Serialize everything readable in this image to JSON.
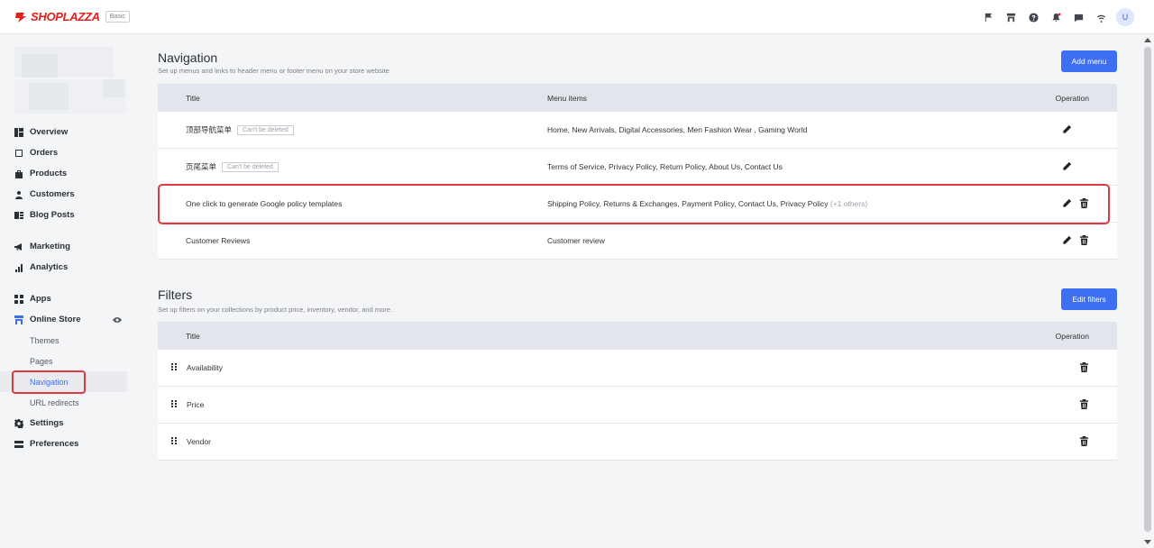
{
  "brand": {
    "name": "SHOPLAZZA",
    "plan": "Basic",
    "accent": "#e3201b"
  },
  "topbar": {
    "avatar_letter": "U",
    "icons": [
      "flag-icon",
      "store-icon",
      "help-icon",
      "bell-icon",
      "message-icon",
      "wifi-icon"
    ]
  },
  "sidebar": {
    "items": [
      {
        "label": "Overview",
        "icon": "overview-icon"
      },
      {
        "label": "Orders",
        "icon": "orders-icon"
      },
      {
        "label": "Products",
        "icon": "products-icon"
      },
      {
        "label": "Customers",
        "icon": "customers-icon"
      },
      {
        "label": "Blog Posts",
        "icon": "blog-icon"
      },
      {
        "label": "Marketing",
        "icon": "megaphone-icon"
      },
      {
        "label": "Analytics",
        "icon": "analytics-icon"
      },
      {
        "label": "Apps",
        "icon": "apps-icon"
      },
      {
        "label": "Online Store",
        "icon": "store-icon"
      },
      {
        "label": "Settings",
        "icon": "gear-icon"
      },
      {
        "label": "Preferences",
        "icon": "preferences-icon"
      }
    ],
    "sub_items": [
      "Themes",
      "Pages",
      "Navigation",
      "URL redirects"
    ],
    "active_sub": "Navigation"
  },
  "navigation": {
    "title": "Navigation",
    "description": "Set up menus and links to header menu or footer menu on your store website",
    "add_button": "Add menu",
    "columns": {
      "title": "Title",
      "items": "Menu items",
      "operation": "Operation"
    },
    "rows": [
      {
        "title": "顶部导航菜单",
        "tag": "Can't be deleted",
        "items": "Home, New Arrivals, Digital Accessories, Men Fashion Wear , Gaming World",
        "extra": ""
      },
      {
        "title": "页尾菜单",
        "tag": "Can't be deleted",
        "items": "Terms of Service, Privacy Policy, Return Policy, About Us, Contact Us",
        "extra": ""
      },
      {
        "title": "One click to generate Google policy templates",
        "tag": "",
        "items": "Shipping Policy, Returns & Exchanges, Payment Policy, Contact Us, Privacy Policy",
        "extra": "(+1 others)"
      },
      {
        "title": "Customer Reviews",
        "tag": "",
        "items": "Customer review",
        "extra": ""
      }
    ]
  },
  "filters": {
    "title": "Filters",
    "description": "Set up filters on your collections by product price, inventory, vendor, and more.",
    "edit_button": "Edit filters",
    "columns": {
      "title": "Title",
      "operation": "Operation"
    },
    "rows": [
      {
        "title": "Availability"
      },
      {
        "title": "Price"
      },
      {
        "title": "Vendor"
      }
    ]
  }
}
